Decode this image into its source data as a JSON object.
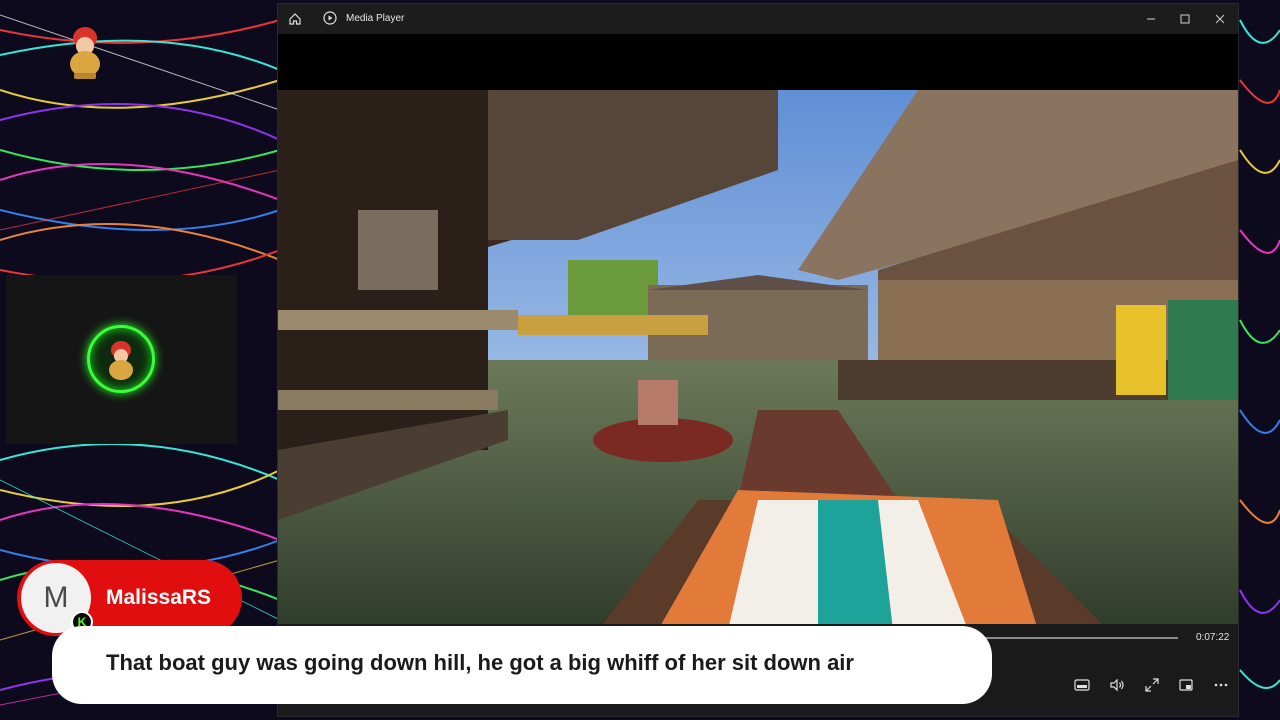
{
  "window": {
    "title": "Media Player",
    "icons": [
      "home-icon",
      "media-player-app-icon",
      "minimize-icon",
      "maximize-icon",
      "close-icon"
    ]
  },
  "player": {
    "total_time": "0:07:22",
    "controls": [
      "subtitles-icon",
      "volume-icon",
      "fullscreen-icon",
      "miniplayer-icon",
      "more-options-icon"
    ],
    "video_scene": "floating market canal with wooden stilt houses and longtail boats"
  },
  "chat": {
    "username": "MalissaRS",
    "avatar_initial": "M",
    "badge": "K",
    "message": "That boat guy was going down hill, he got a big whiff of her sit down air",
    "colors": {
      "name_pill": "#e10e10",
      "badge_green": "#53fc18"
    }
  },
  "overlay": {
    "cam_ring_color": "#38ff38"
  }
}
